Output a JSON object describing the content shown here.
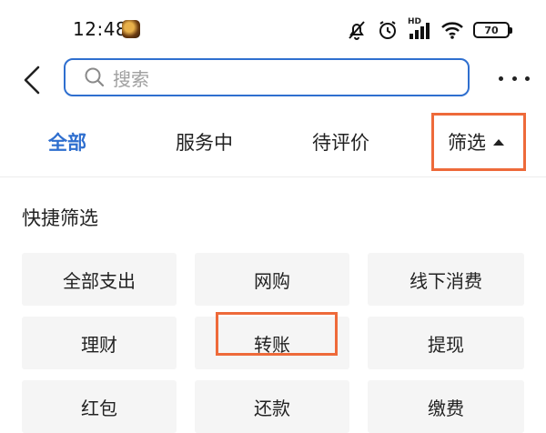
{
  "status_bar": {
    "time": "12:48",
    "network_label": "HD",
    "battery": "70"
  },
  "header": {
    "search": {
      "placeholder": "搜索"
    }
  },
  "tabs": {
    "items": [
      {
        "label": "全部",
        "active": true
      },
      {
        "label": "服务中",
        "active": false
      },
      {
        "label": "待评价",
        "active": false
      }
    ],
    "filter_label": "筛选"
  },
  "quick_filter": {
    "title": "快捷筛选",
    "options": [
      "全部支出",
      "网购",
      "线下消费",
      "理财",
      "转账",
      "提现",
      "红包",
      "还款",
      "缴费"
    ]
  },
  "colors": {
    "accent": "#2f6fcf",
    "highlight": "#ee6a3a",
    "chip_bg": "#f5f5f5"
  }
}
